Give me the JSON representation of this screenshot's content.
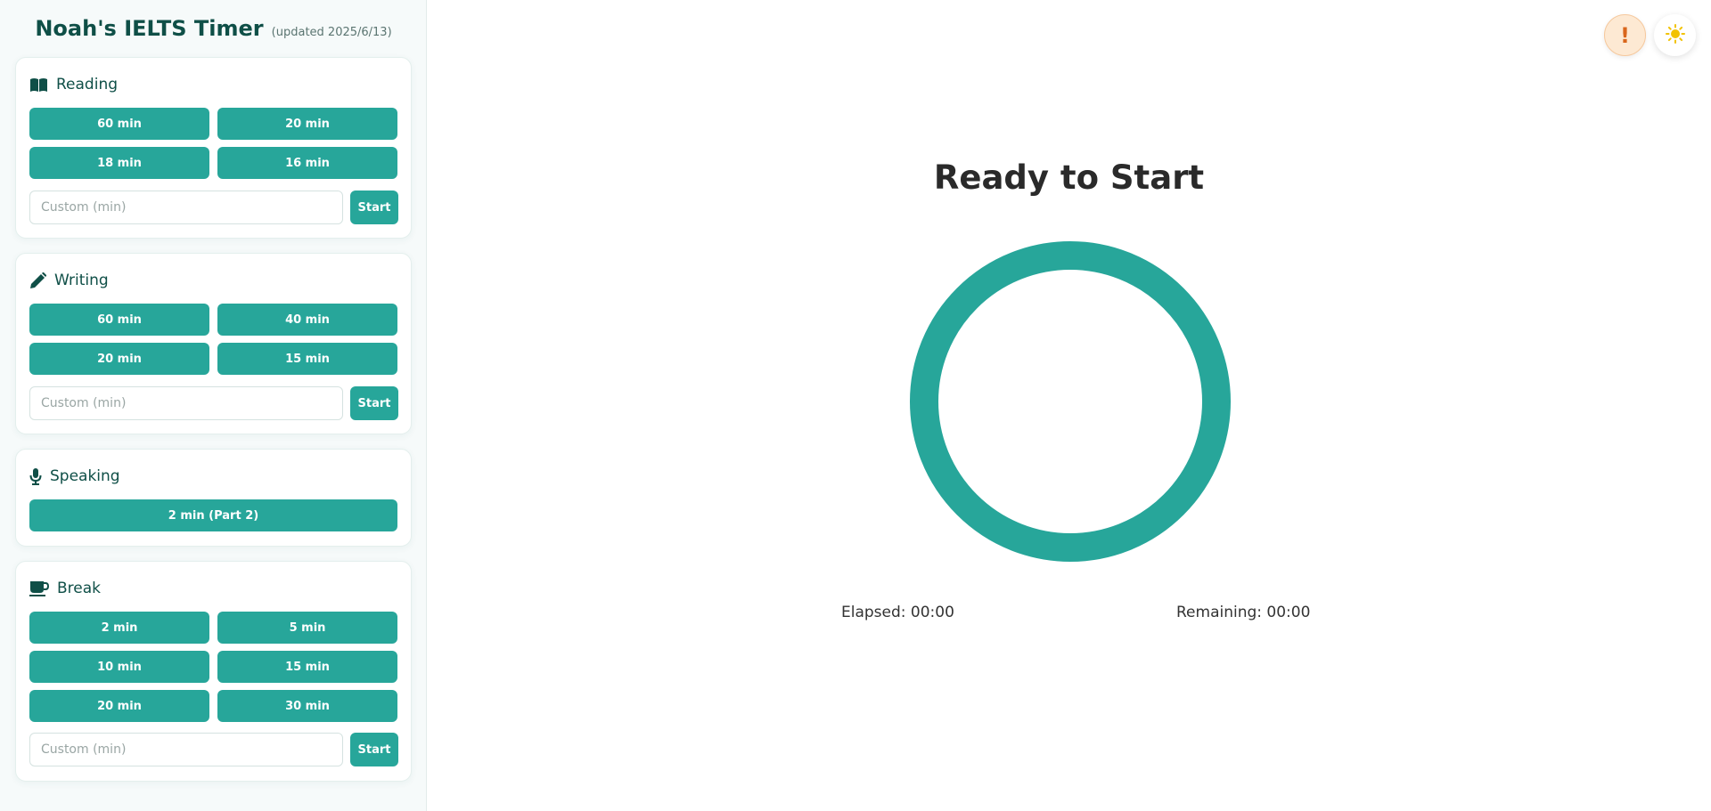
{
  "app": {
    "title": "Noah's IELTS Timer",
    "updated": "(updated 2025/6/13)"
  },
  "colors": {
    "accent": "#27a69a",
    "heading": "#0f4f47",
    "alert_bg": "#fde9d3",
    "alert_fg": "#d9661c",
    "sun": "#f2c200"
  },
  "sections": {
    "reading": {
      "icon": "book-open-icon",
      "label": "Reading",
      "buttons": [
        "60 min",
        "20 min",
        "18 min",
        "16 min"
      ],
      "custom_placeholder": "Custom (min)",
      "start_label": "Start"
    },
    "writing": {
      "icon": "pencil-icon",
      "label": "Writing",
      "buttons": [
        "60 min",
        "40 min",
        "20 min",
        "15 min"
      ],
      "custom_placeholder": "Custom (min)",
      "start_label": "Start"
    },
    "speaking": {
      "icon": "microphone-icon",
      "label": "Speaking",
      "buttons": [
        "2 min (Part 2)"
      ]
    },
    "break": {
      "icon": "coffee-cup-icon",
      "label": "Break",
      "buttons": [
        "2 min",
        "5 min",
        "10 min",
        "15 min",
        "20 min",
        "30 min"
      ],
      "custom_placeholder": "Custom (min)",
      "start_label": "Start"
    }
  },
  "timer": {
    "status": "Ready to Start",
    "elapsed": "Elapsed: 00:00",
    "remaining": "Remaining: 00:00",
    "progress": 0
  },
  "top_buttons": {
    "alert_icon": "exclamation-icon",
    "alert_glyph": "!",
    "theme_icon": "sun-icon"
  }
}
